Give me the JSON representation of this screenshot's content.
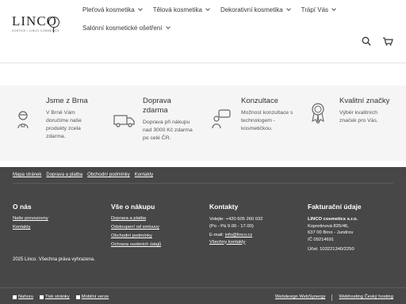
{
  "header": {
    "logo_text": "LINCO",
    "logo_sub": "KOSTICE • LINCO COSMETICS",
    "nav_row1": [
      {
        "label": "Pleťová kosmetika"
      },
      {
        "label": "Tělová kosmetika"
      },
      {
        "label": "Dekorativní kosmetika"
      },
      {
        "label": "Trápí Vás"
      }
    ],
    "nav_row2": [
      {
        "label": "Salónní kosmetické ošetření"
      }
    ],
    "icons": [
      "search-icon",
      "cart-icon"
    ]
  },
  "features": [
    {
      "icon": "delivery-person-icon",
      "title": "Jsme z Brna",
      "desc": [
        "V Brně Vám",
        "doručíme naše",
        "produkty zcela",
        "zdarma."
      ]
    },
    {
      "icon": "truck-icon",
      "title_lines": [
        "Doprava",
        "zdarma"
      ],
      "desc": [
        "Doprava při nákupu",
        "nad 3000 Kč zdarma",
        "po celé ČR."
      ]
    },
    {
      "icon": "consultation-icon",
      "title": "Konzultace",
      "desc": [
        "Možnost konzultace s",
        "technologem -",
        "kosmetičkou."
      ]
    },
    {
      "icon": "quality-badge-icon",
      "title": "Kvalitní značky",
      "desc": [
        "Výběr kvalitních",
        "značek pro Vás."
      ]
    }
  ],
  "footer": {
    "top_links": [
      "Mapa stránek",
      "Doprava a platba",
      "Obchodní podmínky",
      "Kontakty"
    ],
    "columns": {
      "o_nas": {
        "heading": "O nás",
        "links": [
          "Naše provozovny",
          "Kontakty"
        ]
      },
      "nakup": {
        "heading": "Vše o nákupu",
        "links": [
          "Doprava a platba",
          "Odstoupení od smlouvy",
          "Obchodní podmínky",
          "Ochrana osobních údajů"
        ]
      },
      "kontakty": {
        "heading": "Kontakty",
        "lines": [
          "Volejte: +420 605 260 032",
          "(Po - Pá 9.00 - 17.00)"
        ],
        "email_label": "E-mail: ",
        "email": "info@linco.cz",
        "all_link": "Všechny kontakty"
      },
      "fakturace": {
        "heading": "Fakturační údaje",
        "lines": [
          "LINCO cosmetics s.r.o.",
          "Kopretinová 825/46,",
          "637 00 Brno - Jundrov",
          "IČ 09214691"
        ],
        "account": "Účet: 103221340/2250"
      }
    },
    "copyright": "2025 Linco. Všechna práva vyhrazena.",
    "bottom_left": [
      "Nahoru",
      "Tisk stránky",
      "Mobilní verze"
    ],
    "bottom_right": [
      "Webdesign WebSynergy",
      "Webhosting Český hosting"
    ]
  }
}
